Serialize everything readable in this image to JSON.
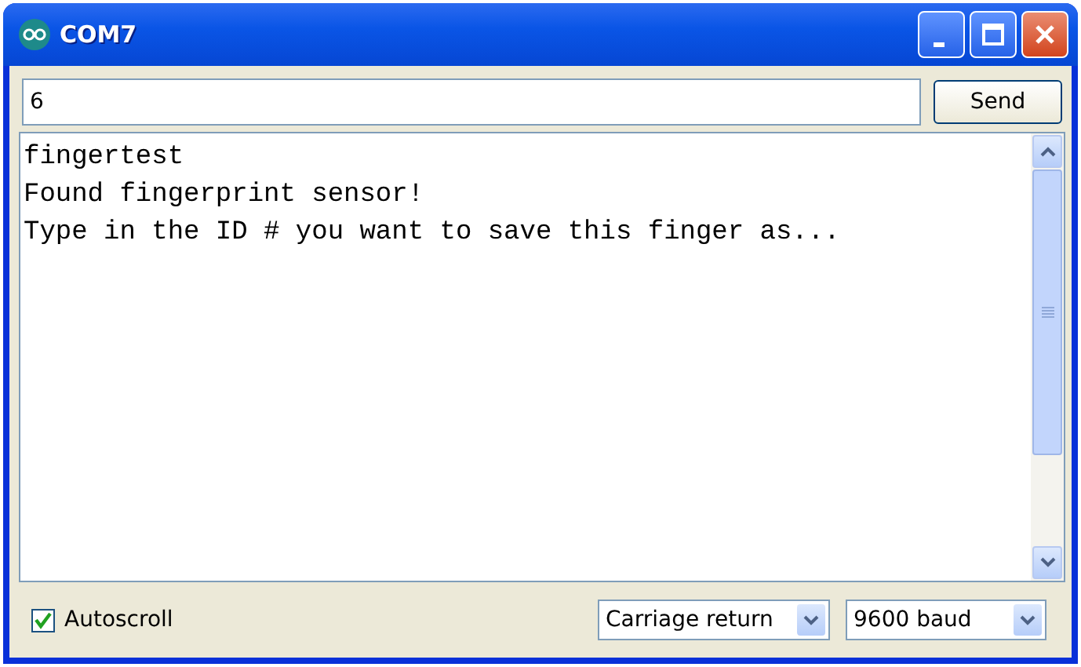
{
  "window": {
    "title": "COM7"
  },
  "input": {
    "value": "6"
  },
  "send_button": {
    "label": "Send"
  },
  "output_lines": [
    "fingertest",
    "Found fingerprint sensor!",
    "Type in the ID # you want to save this finger as..."
  ],
  "autoscroll": {
    "label": "Autoscroll",
    "checked": true
  },
  "line_ending": {
    "value": "Carriage return"
  },
  "baud_rate": {
    "value": "9600 baud"
  }
}
